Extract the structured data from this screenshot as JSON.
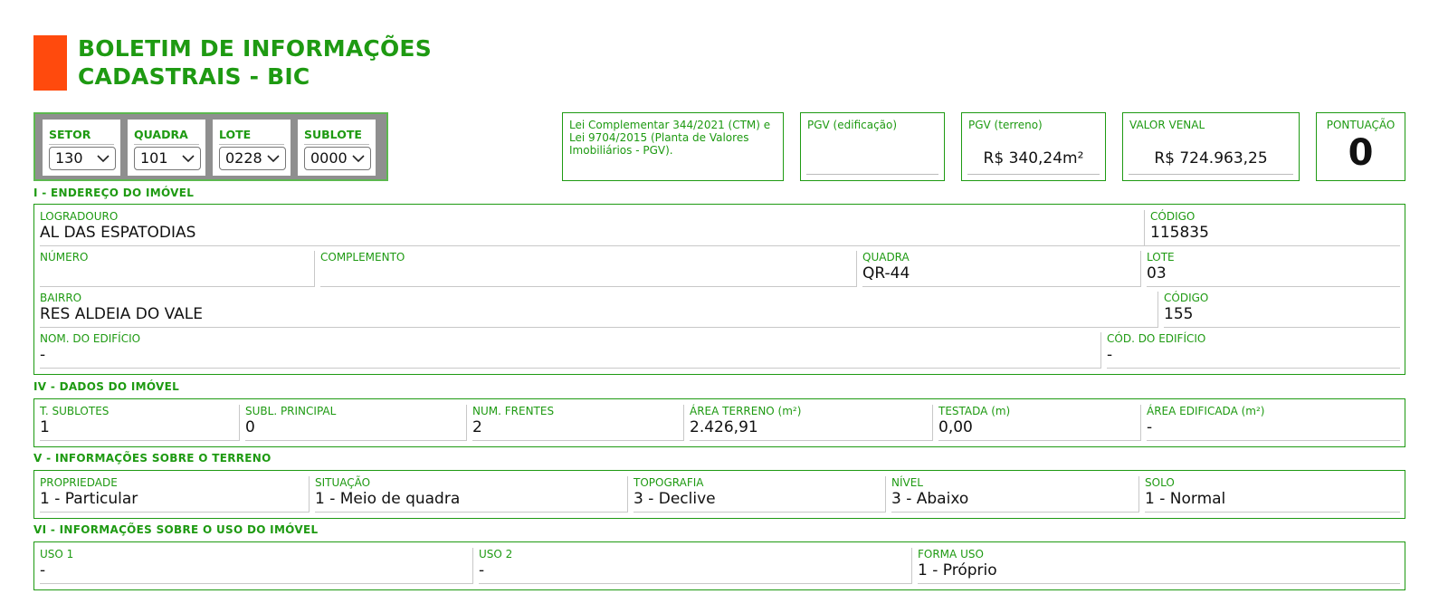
{
  "header": {
    "title_line1": "BOLETIM DE INFORMAÇÕES",
    "title_line2": "CADASTRAIS - BIC",
    "logo_color": "#ff4a0d",
    "accent_color": "#1e9a12"
  },
  "selectors": [
    {
      "label": "SETOR",
      "value": "130"
    },
    {
      "label": "QUADRA",
      "value": "101"
    },
    {
      "label": "LOTE",
      "value": "0228"
    },
    {
      "label": "SUBLOTE",
      "value": "0000"
    }
  ],
  "legal_note": {
    "line1": "Lei Complementar 344/2021 (CTM) e",
    "line2": "Lei 9704/2015 (Planta de Valores",
    "line3": "Imobiliários - PGV)."
  },
  "pgv_edificacao": {
    "label": "PGV (edificação)",
    "value": ""
  },
  "pgv_terreno": {
    "label": "PGV (terreno)",
    "value": "R$ 340,24m²"
  },
  "valor_venal": {
    "label": "VALOR VENAL",
    "value": "R$ 724.963,25"
  },
  "pontuacao": {
    "label": "PONTUAÇÃO",
    "value": "0"
  },
  "endereco": {
    "title": "I - ENDEREÇO DO IMÓVEL",
    "logradouro": {
      "label": "LOGRADOURO",
      "value": "AL DAS ESPATODIAS"
    },
    "codigo_logradouro": {
      "label": "CÓDIGO",
      "value": "115835"
    },
    "numero": {
      "label": "NÚMERO",
      "value": ""
    },
    "complemento": {
      "label": "COMPLEMENTO",
      "value": ""
    },
    "quadra": {
      "label": "QUADRA",
      "value": "QR-44"
    },
    "lote": {
      "label": "LOTE",
      "value": "03"
    },
    "bairro": {
      "label": "BAIRRO",
      "value": "RES ALDEIA DO VALE"
    },
    "codigo_bairro": {
      "label": "CÓDIGO",
      "value": "155"
    },
    "nome_edificio": {
      "label": "NOM. DO EDIFÍCIO",
      "value": "-"
    },
    "cod_edificio": {
      "label": "CÓD. DO EDIFÍCIO",
      "value": "-"
    }
  },
  "dados": {
    "title": "IV - DADOS DO IMÓVEL",
    "fields": [
      {
        "label": "T. SUBLOTES",
        "value": "1"
      },
      {
        "label": "SUBL. PRINCIPAL",
        "value": "0"
      },
      {
        "label": "NUM. FRENTES",
        "value": "2"
      },
      {
        "label": "ÁREA TERRENO (m²)",
        "value": "2.426,91"
      },
      {
        "label": "TESTADA (m)",
        "value": "0,00"
      },
      {
        "label": "ÁREA EDIFICADA (m²)",
        "value": "-"
      }
    ]
  },
  "terreno": {
    "title": "V - INFORMAÇÕES SOBRE O TERRENO",
    "fields": [
      {
        "label": "PROPRIEDADE",
        "value": "1 - Particular"
      },
      {
        "label": "SITUAÇÃO",
        "value": "1 - Meio de quadra"
      },
      {
        "label": "TOPOGRAFIA",
        "value": "3 - Declive"
      },
      {
        "label": "NÍVEL",
        "value": "3 - Abaixo"
      },
      {
        "label": "SOLO",
        "value": "1 - Normal"
      }
    ]
  },
  "uso": {
    "title": "VI - INFORMAÇÕES SOBRE O USO DO IMÓVEL",
    "fields": [
      {
        "label": "USO 1",
        "value": "-"
      },
      {
        "label": "USO 2",
        "value": "-"
      },
      {
        "label": "FORMA USO",
        "value": "1 - Próprio"
      }
    ]
  }
}
